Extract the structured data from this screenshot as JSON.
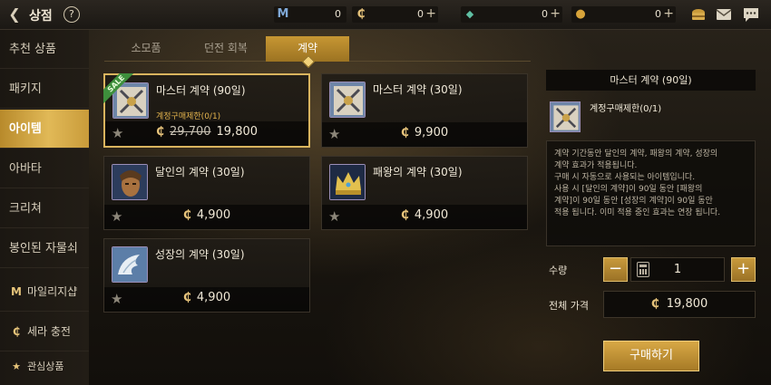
{
  "header": {
    "title": "상점",
    "help_label": "?",
    "currencies": [
      {
        "icon": "mileage-icon",
        "glyph": "M",
        "value": "0",
        "color": "#7fa8d6",
        "has_plus": false
      },
      {
        "icon": "sera-coin-icon",
        "glyph": "₵",
        "value": "0",
        "color": "#e5c27a",
        "has_plus": true
      },
      {
        "icon": "gem-icon",
        "glyph": "◆",
        "value": "0",
        "color": "#5fbfa3",
        "has_plus": true
      },
      {
        "icon": "gold-coin-icon",
        "glyph": "●",
        "value": "0",
        "color": "#d8a43a",
        "has_plus": true
      }
    ]
  },
  "sidebar": {
    "items": [
      {
        "label": "추천 상품",
        "icon": ""
      },
      {
        "label": "패키지",
        "icon": ""
      },
      {
        "label": "아이템",
        "icon": "",
        "active": true
      },
      {
        "label": "아바타",
        "icon": ""
      },
      {
        "label": "크리쳐",
        "icon": ""
      },
      {
        "label": "봉인된 자물쇠",
        "icon": ""
      },
      {
        "label": "마일리지샵",
        "icon": "M"
      },
      {
        "label": "세라 충전",
        "icon": "₵"
      },
      {
        "label": "관심상품",
        "icon": "★"
      }
    ]
  },
  "tabs": [
    {
      "label": "소모품"
    },
    {
      "label": "던전 회복"
    },
    {
      "label": "계약",
      "active": true
    }
  ],
  "products": [
    {
      "name": "마스터 계약 (90일)",
      "limit": "계정구매제한(0/1)",
      "sale_badge": "SALE",
      "old_price": "29,700",
      "price": "19,800",
      "thumb": "crossed-swords"
    },
    {
      "name": "마스터 계약 (30일)",
      "limit": "",
      "sale_badge": "",
      "old_price": "",
      "price": "9,900",
      "thumb": "crossed-swords"
    },
    {
      "name": "달인의 계약 (30일)",
      "limit": "",
      "sale_badge": "",
      "old_price": "",
      "price": "4,900",
      "thumb": "warrior"
    },
    {
      "name": "패왕의 계약 (30일)",
      "limit": "",
      "sale_badge": "",
      "old_price": "",
      "price": "4,900",
      "thumb": "crown"
    },
    {
      "name": "성장의 계약 (30일)",
      "limit": "",
      "sale_badge": "",
      "old_price": "",
      "price": "4,900",
      "thumb": "wings"
    }
  ],
  "detail": {
    "title": "마스터 계약 (90일)",
    "limit": "계정구매제한(0/1)",
    "description": [
      "계약 기간동안 달인의 계약, 패왕의 계약, 성장의",
      "계약 효과가 적용됩니다.",
      "구매 시 자동으로 사용되는 아이템입니다.",
      "사용 시 [달인의 계약]이 90일 동안 [패왕의",
      "계약]이 90일 동안 [성장의 계약]이 90일 동안",
      "적용 됩니다. 이미 적용 중인 효과는 연장 됩니다."
    ],
    "quantity_label": "수량",
    "quantity": "1",
    "total_label": "전체 가격",
    "total_price": "19,800",
    "buy_label": "구매하기"
  },
  "colors": {
    "accent": "#c99a3a",
    "sale_green": "#3e8f3c",
    "limit_text": "#e3b34d"
  }
}
